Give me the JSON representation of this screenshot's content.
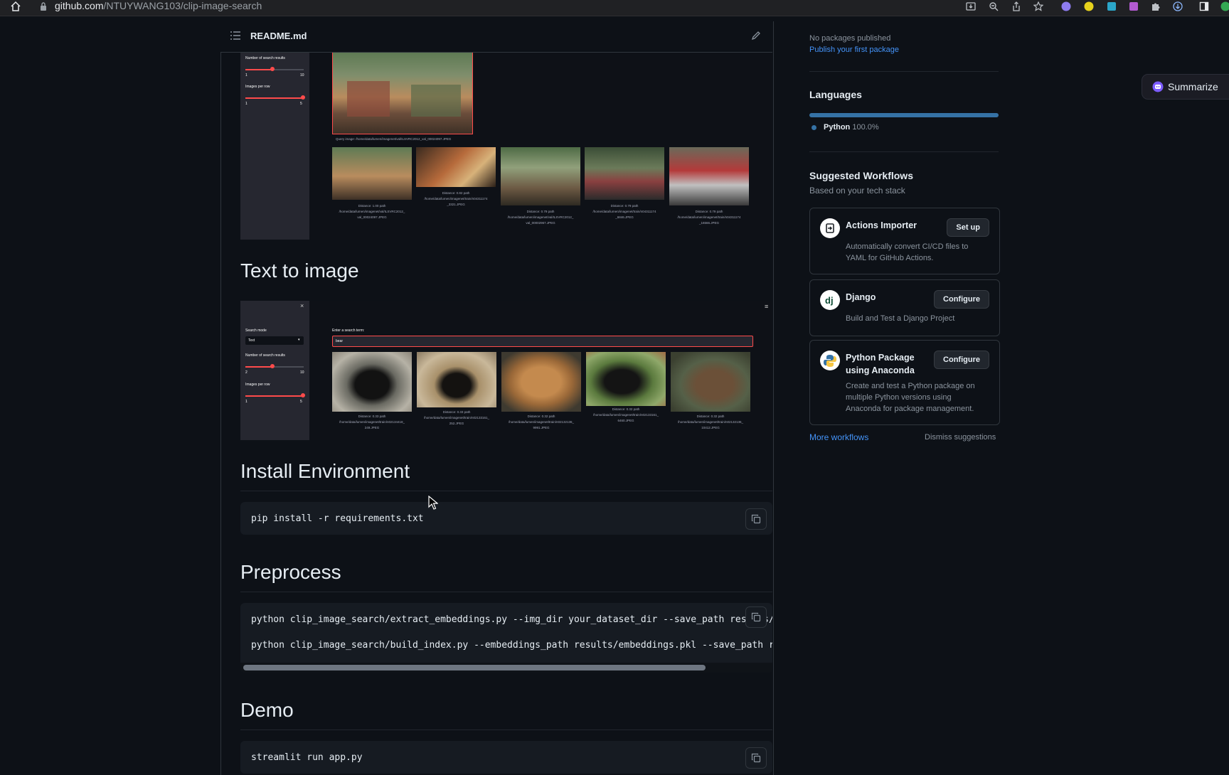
{
  "browser": {
    "url_domain": "github.com",
    "url_path": "/NTUYWANG103/clip-image-search"
  },
  "readme": {
    "filename": "README.md",
    "shot1": {
      "num_results_label": "Number of search results",
      "num_results_min": "1",
      "num_results_max": "10",
      "images_per_row_label": "Images per row",
      "images_per_row_min": "1",
      "images_per_row_max": "5",
      "query_caption": "Query image: /home/data/lumen/imagenet/val/ILSVRC2012_val_00024097.JPEG",
      "captions": [
        [
          "Distance: 1.00 path",
          "/home/data/lumen/imagenet/val/ILSVRC2012_",
          "val_00024097.JPEG"
        ],
        [
          "Distance: 0.82 path",
          "/home/data/lumen/imagenet/train/n04311174",
          "_3321.JPEG"
        ],
        [
          "Distance: 0.79 path",
          "/home/data/lumen/imagenet/val/ILSVRC2012_",
          "val_00002967.JPEG"
        ],
        [
          "Distance: 0.79 path",
          "/home/data/lumen/imagenet/train/n04311174",
          "_6846.JPEG"
        ],
        [
          "Distance: 0.79 path",
          "/home/data/lumen/imagenet/train/n04311174",
          "_16566.JPEG"
        ]
      ]
    },
    "sections": {
      "text_to_image": "Text to image",
      "install": "Install Environment",
      "preprocess": "Preprocess",
      "demo": "Demo"
    },
    "shot2": {
      "close": "×",
      "menu": "≡",
      "search_mode_label": "Search mode",
      "search_mode_value": "Text",
      "num_results_label": "Number of search results",
      "num_results_min": "2",
      "num_results_max": "10",
      "images_per_row_label": "Images per row",
      "images_per_row_min": "1",
      "images_per_row_max": "5",
      "search_term_label": "Enter a search term:",
      "search_term_value": "bear",
      "captions": [
        [
          "Distance: 0.33 path",
          "/home/data/lumen/imagenet/train/n02134418_",
          "249.JPEG"
        ],
        [
          "Distance: 0.33 path",
          "/home/data/lumen/imagenet/train/n02133161_",
          "252.JPEG"
        ],
        [
          "Distance: 0.32 path",
          "/home/data/lumen/imagenet/train/n02132136_",
          "9991.JPEG"
        ],
        [
          "Distance: 0.32 path",
          "/home/data/lumen/imagenet/train/n02133161_",
          "6460.JPEG"
        ],
        [
          "Distance: 0.32 path",
          "/home/data/lumen/imagenet/train/n02132136_",
          "10412.JPEG"
        ]
      ]
    },
    "code": {
      "install": "pip install -r requirements.txt",
      "preprocess_1": "python clip_image_search/extract_embeddings.py --img_dir your_dataset_dir --save_path results/e",
      "preprocess_2": "python clip_image_search/build_index.py --embeddings_path results/embeddings.pkl --save_path results",
      "demo": "streamlit run app.py"
    }
  },
  "sidebar": {
    "packages_text": "No packages published",
    "packages_link": "Publish your first package",
    "languages_title": "Languages",
    "language_name": "Python",
    "language_pct": "100.0%",
    "language_fraction": 1.0,
    "language_color": "#3572A5",
    "workflows_title": "Suggested Workflows",
    "workflows_subtitle": "Based on your tech stack",
    "workflows": [
      {
        "title": "Actions Importer",
        "desc1": "Automatically convert CI/CD files to",
        "desc2": "YAML for GitHub Actions.",
        "button": "Set up"
      },
      {
        "title": "Django",
        "desc1": "Build and Test a Django Project",
        "button": "Configure"
      },
      {
        "title1": "Python Package",
        "title2": "using Anaconda",
        "desc1": "Create and test a Python package on",
        "desc2": "multiple Python versions using",
        "desc3": "Anaconda for package management.",
        "button": "Configure"
      }
    ],
    "more_workflows": "More workflows",
    "dismiss": "Dismiss suggestions"
  },
  "extension": {
    "summarize": "Summarize"
  }
}
